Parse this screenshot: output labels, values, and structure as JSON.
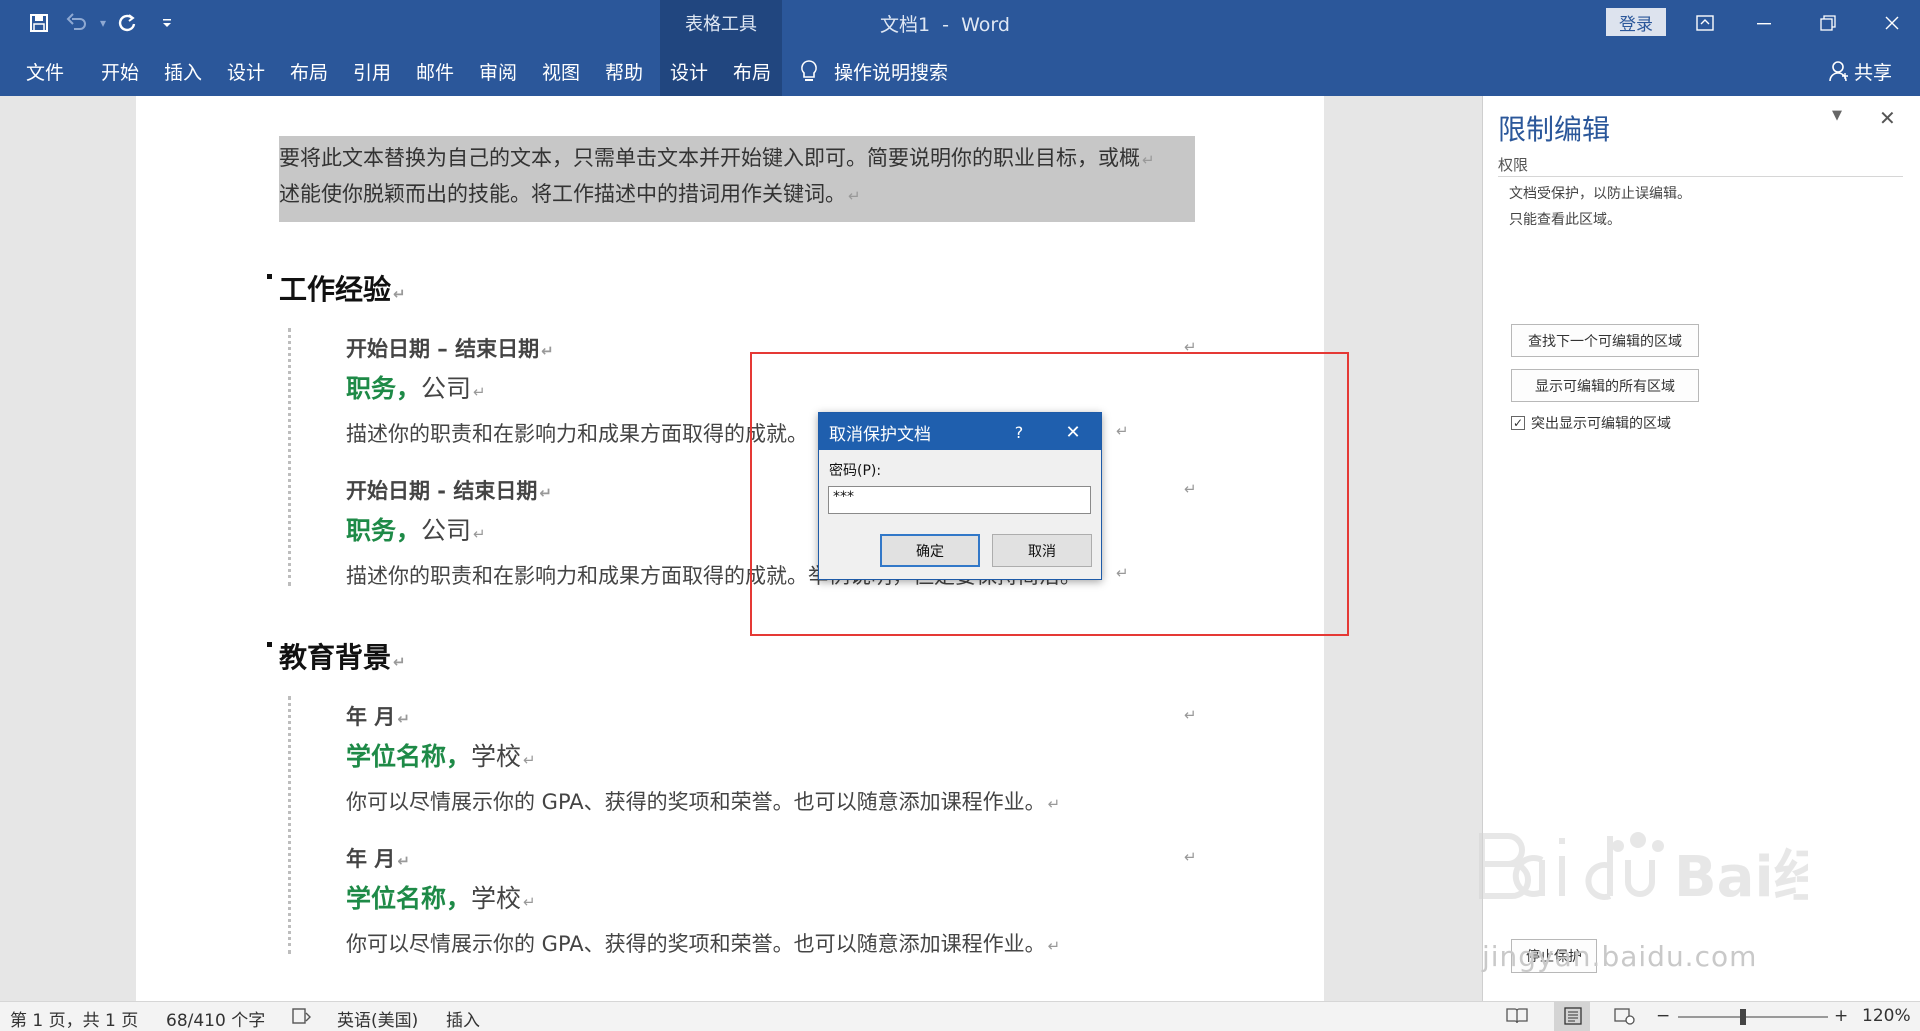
{
  "colors": {
    "ribbon": "#2b579a",
    "context_tab": "#21467f",
    "accent_green": "#1e8a47",
    "highlight_box": "#e53935"
  },
  "title_bar": {
    "quick_access": [
      {
        "name": "save-icon",
        "glyph": "💾"
      },
      {
        "name": "undo-icon",
        "glyph": "↶"
      },
      {
        "name": "redo-icon",
        "glyph": "↻"
      },
      {
        "name": "customize-icon",
        "glyph": "⌄"
      }
    ],
    "context_tab_label": "表格工具",
    "document_title": "文档1  -  Word",
    "login_label": "登录",
    "window_buttons": [
      "ribbon-display-options",
      "minimize",
      "restore",
      "close"
    ]
  },
  "ribbon_tabs": [
    "文件",
    "开始",
    "插入",
    "设计",
    "布局",
    "引用",
    "邮件",
    "审阅",
    "视图",
    "帮助",
    "设计",
    "布局"
  ],
  "search_label": "操作说明搜索",
  "share_label": "共享",
  "document": {
    "intro": [
      "要将此文本替换为自己的文本，只需单击文本并开始键入即可。简要说明你的职业目标，或概",
      "述能使你脱颖而出的技能。将工作描述中的措词用作关键词。"
    ],
    "sections": [
      {
        "heading": "工作经验",
        "entries": [
          {
            "date": "开始日期 – 结束日期",
            "title": "职务，",
            "org": "公司",
            "desc": "描述你的职责和在影响力和成果方面取得的成就。"
          },
          {
            "date": "开始日期 - 结束日期",
            "title": "职务，",
            "org": "公司",
            "desc": "描述你的职责和在影响力和成果方面取得的成就。举例说明，但是要保持简洁。"
          }
        ]
      },
      {
        "heading": "教育背景",
        "entries": [
          {
            "date": "年 月",
            "title": "学位名称，",
            "org": "学校",
            "desc": "你可以尽情展示你的 GPA、获得的奖项和荣誉。也可以随意添加课程作业。"
          },
          {
            "date": "年 月",
            "title": "学位名称，",
            "org": "学校",
            "desc": "你可以尽情展示你的 GPA、获得的奖项和荣誉。也可以随意添加课程作业。"
          }
        ]
      }
    ],
    "paragraph_mark": "↵"
  },
  "dialog": {
    "title": "取消保护文档",
    "help": "?",
    "close": "✕",
    "password_label": "密码(P):",
    "password_value": "***",
    "ok_label": "确定",
    "cancel_label": "取消"
  },
  "restrict_pane": {
    "title": "限制编辑",
    "section": "权限",
    "info": [
      "文档受保护，以防止误编辑。",
      "只能查看此区域。"
    ],
    "find_next_label": "查找下一个可编辑的区域",
    "show_all_label": "显示可编辑的所有区域",
    "highlight_label": "突出显示可编辑的区域",
    "highlight_checked": true,
    "stop_label": "停止保护"
  },
  "watermark": {
    "logo_text": "Bai经验",
    "url": "jingyan.baidu.com"
  },
  "status_bar": {
    "page_info": "第 1 页，共 1 页",
    "word_count": "68/410 个字",
    "language": "英语(美国)",
    "mode": "插入",
    "zoom_out": "−",
    "zoom_in": "+",
    "zoom_level": "120%",
    "zoom_fraction": 0.43
  }
}
